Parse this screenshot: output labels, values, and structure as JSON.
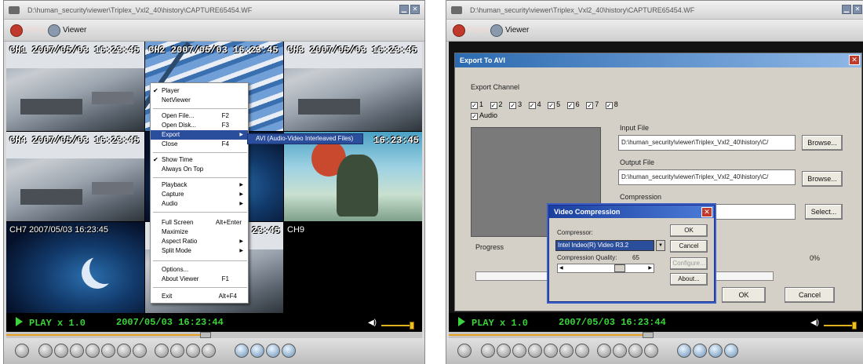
{
  "left": {
    "title": "D:\\human_security\\viewer\\Triplex_Vxl2_40\\history\\CAPTURE65454.WF",
    "modes": {
      "player": "Player",
      "viewer": "Viewer"
    },
    "overlays": {
      "ch1": "CH1 2007/05/03 16:23:45",
      "ch2": "CH2 2007/05/03 16:23:45",
      "ch3": "CH3 2007/05/03 16:23:45",
      "ch4": "CH4 2007/05/03 16:23:45",
      "ch6": "16:23:45",
      "ch7": "CH7 2007/05/03 16:23:45",
      "ch8": "23:45",
      "ch9": "CH9"
    },
    "menu": {
      "player": "Player",
      "netviewer": "NetViewer",
      "open_file": "Open File...",
      "open_file_key": "F2",
      "open_disk": "Open Disk...",
      "open_disk_key": "F3",
      "export": "Export",
      "close": "Close",
      "close_key": "F4",
      "show_time": "Show Time",
      "always_on_top": "Always On Top",
      "playback": "Playback",
      "capture": "Capture",
      "audio": "Audio",
      "full_screen": "Full Screen",
      "full_screen_key": "Alt+Enter",
      "maximize": "Maximize",
      "aspect_ratio": "Aspect Ratio",
      "split_mode": "Split Mode",
      "options": "Options...",
      "about": "About Viewer",
      "about_key": "F1",
      "exit": "Exit",
      "exit_key": "Alt+F4",
      "submenu_avi": "AVI (Audio-Video Interleaved Files)"
    },
    "status": {
      "play": "PLAY x 1.0",
      "timestamp": "2007/05/03 16:23:44"
    },
    "seek_progress": 0.48,
    "volume": 1.0
  },
  "right": {
    "title": "D:\\human_security\\viewer\\Triplex_Vxl2_40\\history\\CAPTURE65454.WF",
    "modes": {
      "player": "Player",
      "viewer": "Viewer"
    },
    "export_dialog": {
      "title": "Export To AVI",
      "export_channel": "Export Channel",
      "channels": [
        "1",
        "2",
        "3",
        "4",
        "5",
        "6",
        "7",
        "8"
      ],
      "audio": "Audio",
      "input_file_label": "Input File",
      "input_file": "D:\\human_security\\viewer\\Triplex_Vxl2_40\\history\\C/",
      "output_file_label": "Output File",
      "output_file": "D:\\human_security\\viewer\\Triplex_Vxl2_40\\history\\C/",
      "compression_label": "Compression",
      "browse": "Browse...",
      "select": "Select...",
      "progress_label": "Progress",
      "progress_value": "0%",
      "ok": "OK",
      "cancel": "Cancel"
    },
    "compression_dialog": {
      "title": "Video Compression",
      "compressor_label": "Compressor:",
      "compressor_value": "Intel Indeo(R) Video R3.2",
      "quality_label": "Compression Quality:",
      "quality_value": "65",
      "ok": "OK",
      "cancel": "Cancel",
      "configure": "Configure...",
      "about": "About..."
    },
    "status": {
      "play": "PLAY x 1.0",
      "timestamp": "2007/05/03 16:23:44"
    }
  }
}
